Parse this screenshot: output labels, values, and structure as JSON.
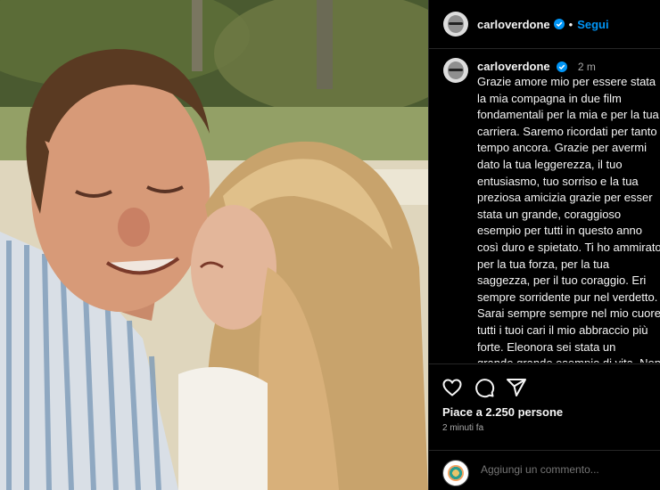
{
  "post": {
    "username": "carloverdone",
    "follow_label": "Segui",
    "separator": "•",
    "caption_time": "2 m",
    "caption": "Grazie amore mio per essere stata la mia compagna in due film fondamentali per la mia e per la tua carriera. Saremo ricordati per tanto tempo ancora. Grazie per avermi dato la tua leggerezza, il tuo entusiasmo, tuo sorriso e la tua preziosa amicizia grazie per esser stata un grande, coraggioso esempio per tutti in questo anno così duro e spietato. Ti ho ammirato per la tua forza, per la tua saggezza, per il tuo coraggio. Eri sempre sorridente pur nel verdetto. Sarai sempre sempre nel mio cuore. tutti i tuoi cari il mio abbraccio più forte. Eleonora sei stata un grande,grande esempio di vita. Non dimenticherò i tuoi ultimi messaggi pieni di dolcezza e vero affetto. Dio ti benedica e ti accolga nel suo",
    "likes": "Piace a 2.250 persone",
    "posted_ago": "2 minuti fa",
    "comment_placeholder": "Aggiungi un commento..."
  },
  "icons": {
    "verified": "verified-badge-icon",
    "like": "heart-icon",
    "comment": "comment-bubble-icon",
    "share": "paper-plane-icon"
  },
  "colors": {
    "background": "#000000",
    "text": "#f5f5f5",
    "secondary_text": "#a8a8a8",
    "link": "#0095f6",
    "divider": "#262626"
  }
}
